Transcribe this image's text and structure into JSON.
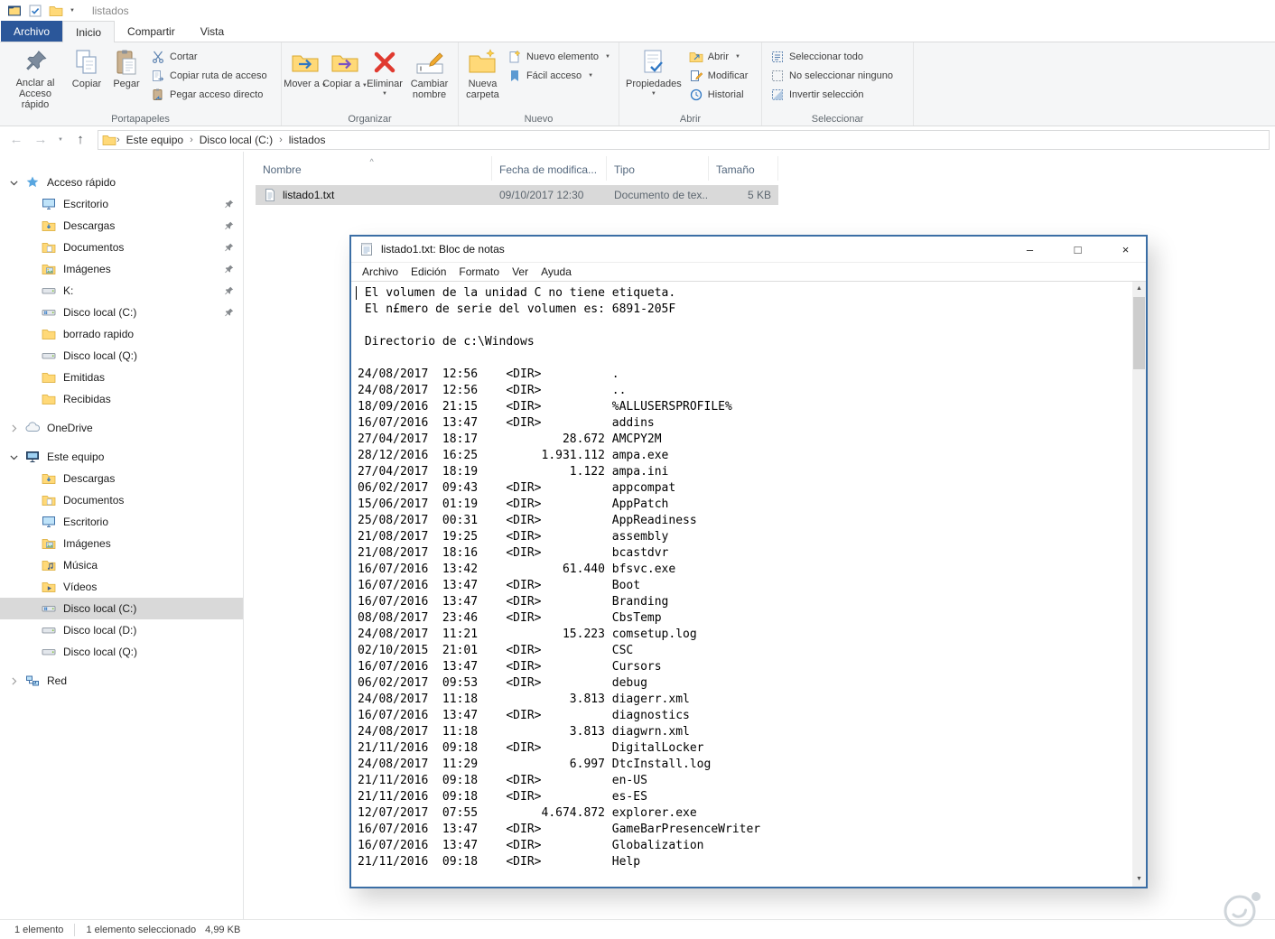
{
  "icons": {
    "dropdown": "▼",
    "back": "←",
    "forward": "→",
    "up": "↑",
    "breadcrumb_sep": "›",
    "sort_asc": "^",
    "minimize": "–",
    "maximize": "□",
    "close": "×",
    "scroll_up": "▲",
    "scroll_down": "▼"
  },
  "colors": {
    "file_tab_blue": "#2b579a",
    "window_border_blue": "#3b6ea5",
    "selection_gray": "#d9d9d9"
  },
  "explorer": {
    "titlebar": {
      "title": "listados"
    },
    "tabs": [
      {
        "label": "Archivo"
      },
      {
        "label": "Inicio"
      },
      {
        "label": "Compartir"
      },
      {
        "label": "Vista"
      }
    ],
    "ribbon": {
      "pin": "Anclar al Acceso rápido",
      "copy": "Copiar",
      "paste": "Pegar",
      "cut": "Cortar",
      "copy_path": "Copiar ruta de acceso",
      "paste_shortcut": "Pegar acceso directo",
      "move_to": "Mover a",
      "copy_to": "Copiar a",
      "delete": "Eliminar",
      "rename": "Cambiar nombre",
      "new_folder": "Nueva carpeta",
      "new_item": "Nuevo elemento",
      "easy_access": "Fácil acceso",
      "properties": "Propiedades",
      "open": "Abrir",
      "edit": "Modificar",
      "history": "Historial",
      "select_all": "Seleccionar todo",
      "select_none": "No seleccionar ninguno",
      "invert_selection": "Invertir selección",
      "group_clipboard": "Portapapeles",
      "group_organize": "Organizar",
      "group_new": "Nuevo",
      "group_open": "Abrir",
      "group_select": "Seleccionar"
    },
    "navbar": {
      "breadcrumb": [
        "Este equipo",
        "Disco local (C:)",
        "listados"
      ]
    },
    "sidebar": {
      "sections": {
        "quick_access": "Acceso rápido",
        "onedrive": "OneDrive",
        "this_pc": "Este equipo",
        "network": "Red"
      },
      "quick_access_items": [
        {
          "label": "Escritorio"
        },
        {
          "label": "Descargas"
        },
        {
          "label": "Documentos"
        },
        {
          "label": "Imágenes"
        },
        {
          "label": "K:"
        },
        {
          "label": "Disco local (C:)"
        },
        {
          "label": "borrado rapido"
        },
        {
          "label": "Disco local (Q:)"
        },
        {
          "label": "Emitidas"
        },
        {
          "label": "Recibidas"
        }
      ],
      "this_pc_items": [
        {
          "label": "Descargas"
        },
        {
          "label": "Documentos"
        },
        {
          "label": "Escritorio"
        },
        {
          "label": "Imágenes"
        },
        {
          "label": "Música"
        },
        {
          "label": "Vídeos"
        },
        {
          "label": "Disco local (C:)"
        },
        {
          "label": "Disco local (D:)"
        },
        {
          "label": "Disco local (Q:)"
        }
      ]
    },
    "files": {
      "columns": [
        "Nombre",
        "Fecha de modifica...",
        "Tipo",
        "Tamaño"
      ],
      "rows": [
        {
          "name": "listado1.txt",
          "modified": "09/10/2017 12:30",
          "type": "Documento de tex...",
          "size": "5 KB"
        }
      ]
    },
    "statusbar": {
      "count": "1 elemento",
      "selected": "1 elemento seleccionado",
      "size": "4,99 KB"
    }
  },
  "notepad": {
    "title": "listado1.txt: Bloc de notas",
    "menu": [
      "Archivo",
      "Edición",
      "Formato",
      "Ver",
      "Ayuda"
    ],
    "content_lines": [
      " El volumen de la unidad C no tiene etiqueta.",
      " El n£mero de serie del volumen es: 6891-205F",
      "",
      " Directorio de c:\\Windows",
      "",
      "24/08/2017  12:56    <DIR>          .",
      "24/08/2017  12:56    <DIR>          ..",
      "18/09/2016  21:15    <DIR>          %ALLUSERSPROFILE%",
      "16/07/2016  13:47    <DIR>          addins",
      "27/04/2017  18:17            28.672 AMCPY2M",
      "28/12/2016  16:25         1.931.112 ampa.exe",
      "27/04/2017  18:19             1.122 ampa.ini",
      "06/02/2017  09:43    <DIR>          appcompat",
      "15/06/2017  01:19    <DIR>          AppPatch",
      "25/08/2017  00:31    <DIR>          AppReadiness",
      "21/08/2017  19:25    <DIR>          assembly",
      "21/08/2017  18:16    <DIR>          bcastdvr",
      "16/07/2016  13:42            61.440 bfsvc.exe",
      "16/07/2016  13:47    <DIR>          Boot",
      "16/07/2016  13:47    <DIR>          Branding",
      "08/08/2017  23:46    <DIR>          CbsTemp",
      "24/08/2017  11:21            15.223 comsetup.log",
      "02/10/2015  21:01    <DIR>          CSC",
      "16/07/2016  13:47    <DIR>          Cursors",
      "06/02/2017  09:53    <DIR>          debug",
      "24/08/2017  11:18             3.813 diagerr.xml",
      "16/07/2016  13:47    <DIR>          diagnostics",
      "24/08/2017  11:18             3.813 diagwrn.xml",
      "21/11/2016  09:18    <DIR>          DigitalLocker",
      "24/08/2017  11:29             6.997 DtcInstall.log",
      "21/11/2016  09:18    <DIR>          en-US",
      "21/11/2016  09:18    <DIR>          es-ES",
      "12/07/2017  07:55         4.674.872 explorer.exe",
      "16/07/2016  13:47    <DIR>          GameBarPresenceWriter",
      "16/07/2016  13:47    <DIR>          Globalization",
      "21/11/2016  09:18    <DIR>          Help"
    ]
  }
}
